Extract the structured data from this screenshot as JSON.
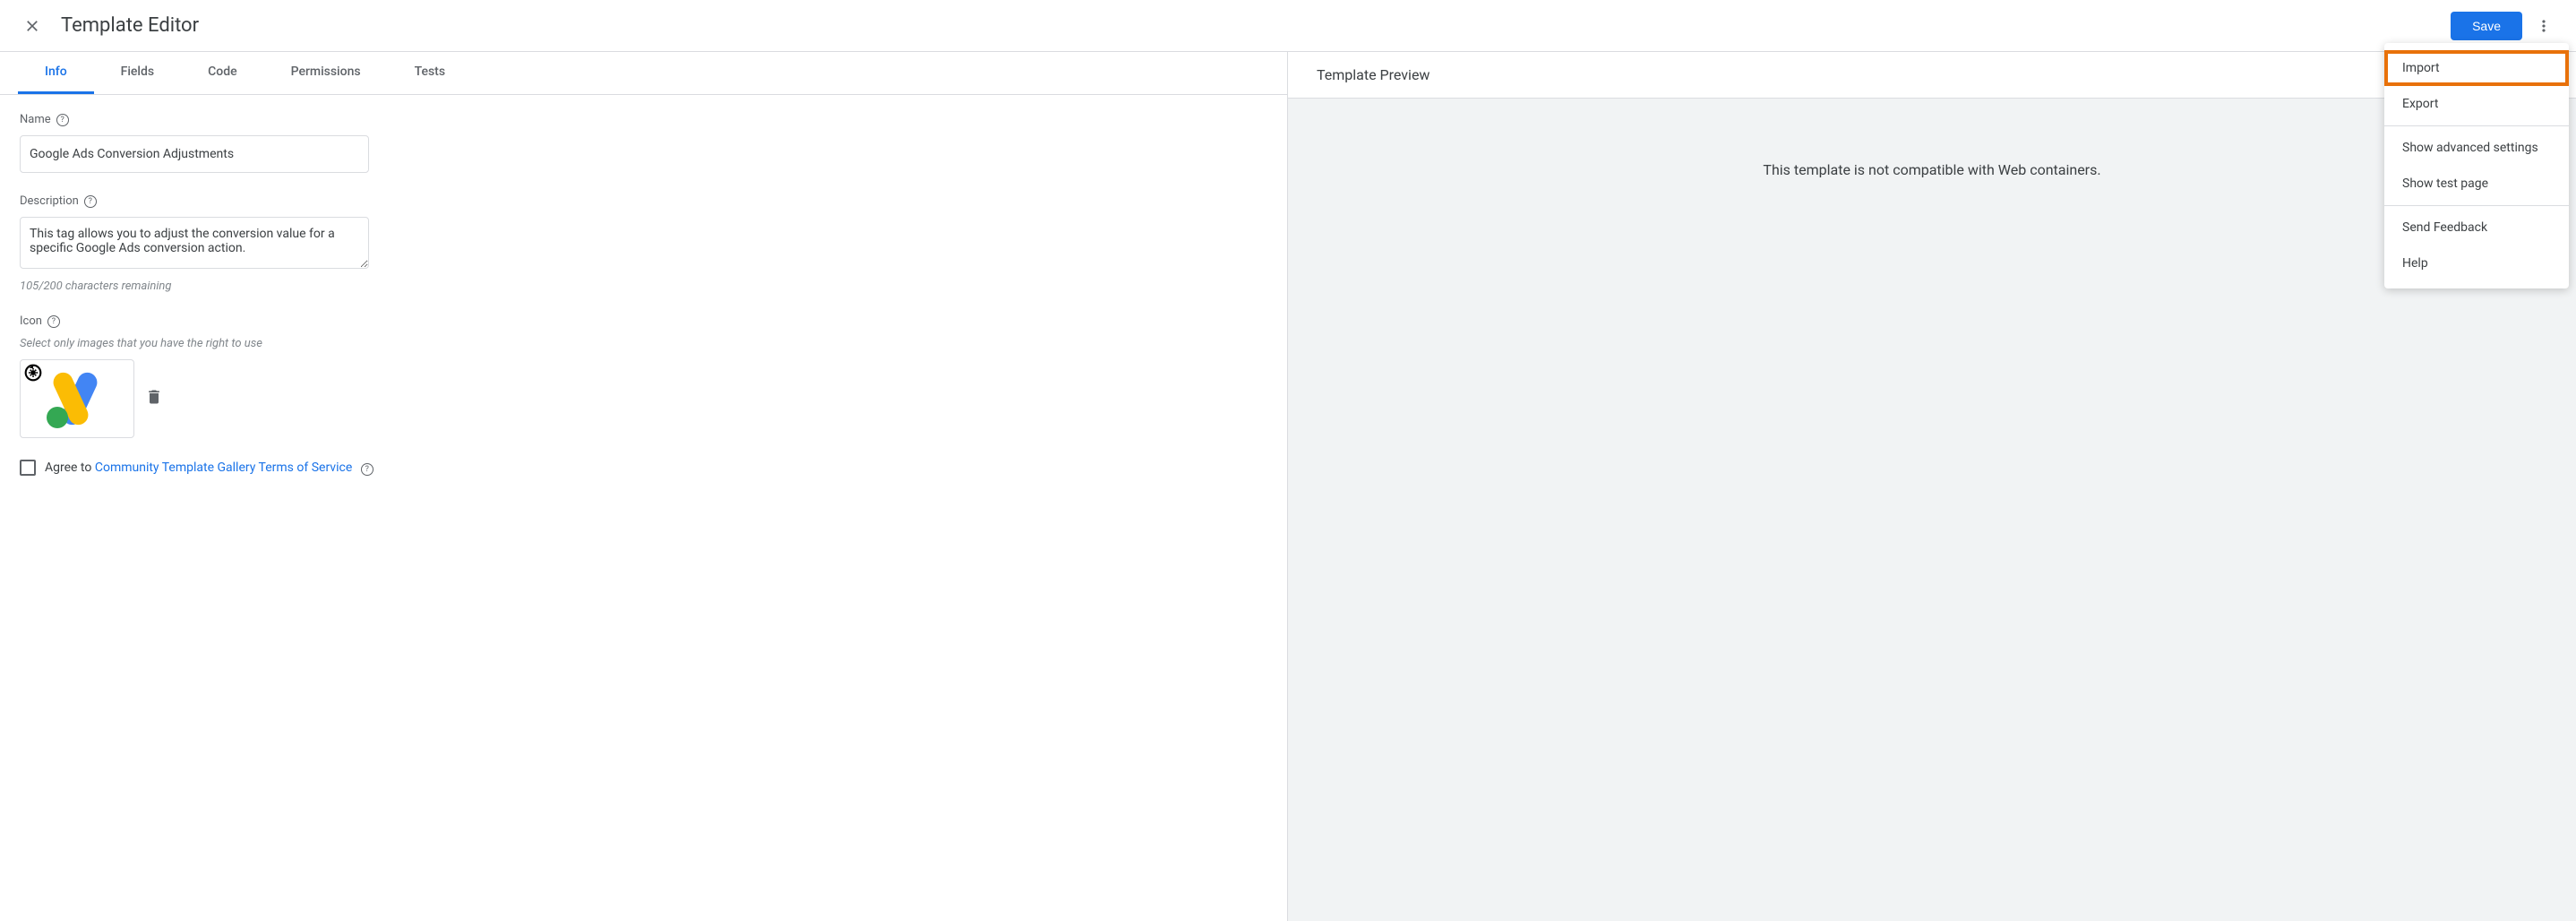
{
  "header": {
    "title": "Template Editor",
    "save_label": "Save"
  },
  "tabs": [
    {
      "label": "Info"
    },
    {
      "label": "Fields"
    },
    {
      "label": "Code"
    },
    {
      "label": "Permissions"
    },
    {
      "label": "Tests"
    }
  ],
  "form": {
    "name_label": "Name",
    "name_value": "Google Ads Conversion Adjustments",
    "description_label": "Description",
    "description_value": "This tag allows you to adjust the conversion value for a specific Google Ads conversion action.",
    "description_hint": "105/200 characters remaining",
    "icon_label": "Icon",
    "icon_hint": "Select only images that you have the right to use",
    "agree_prefix": "Agree to ",
    "agree_link": "Community Template Gallery Terms of Service"
  },
  "preview": {
    "header": "Template Preview",
    "body_text": "This template is not compatible with Web containers."
  },
  "menu": {
    "import": "Import",
    "export": "Export",
    "advanced": "Show advanced settings",
    "test_page": "Show test page",
    "feedback": "Send Feedback",
    "help": "Help"
  }
}
